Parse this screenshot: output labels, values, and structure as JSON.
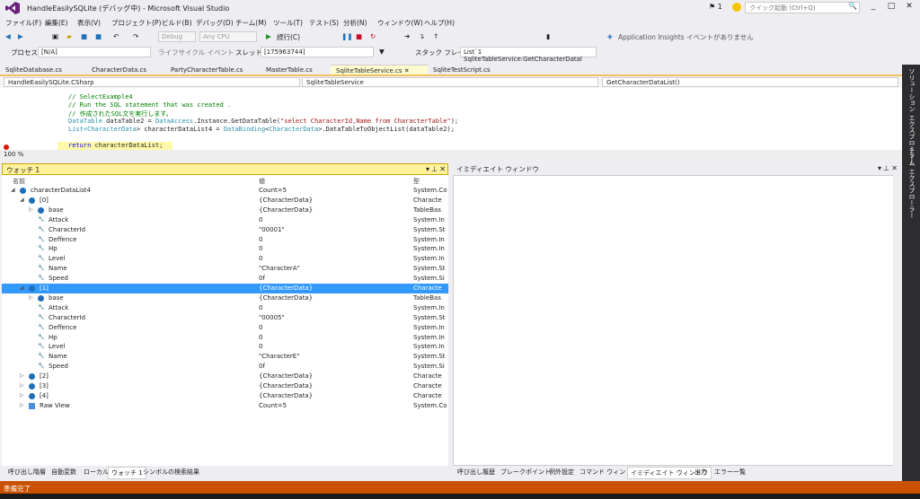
{
  "titlebar": {
    "title": "HandleEasilySQLite (デバッグ中) - Microsoft Visual Studio",
    "notifications": "1",
    "quick_launch_placeholder": "クイック起動 (Ctrl+Q)",
    "minimize": "_",
    "maximize": "□",
    "close": "✕",
    "filter_icon": "🔍"
  },
  "menu": [
    "ファイル(F)",
    "編集(E)",
    "表示(V)",
    "プロジェクト(P)",
    "ビルド(B)",
    "デバッグ(D)",
    "チーム(M)",
    "ツール(T)",
    "テスト(S)",
    "分析(N)",
    "ウィンドウ(W)",
    "ヘルプ(H)"
  ],
  "toolbar1": {
    "config": "Debug",
    "platform": "Any CPU",
    "continue": "続行(C)",
    "insights": "Application Insights イベントがありません"
  },
  "toolbar2": {
    "process_label": "プロセス:",
    "process_value": "[N/A]",
    "lifecycle": "ライフサイクル イベント",
    "thread_label": "スレッド:",
    "thread_value": "[175963744]",
    "stack_label": "スタック フレーム:",
    "stack_value": "List`1 SqliteTableService:GetCharacterDatal"
  },
  "doctabs": [
    "SqliteDatabase.cs",
    "CharacterData.cs",
    "PartyCharacterTable.cs",
    "MasterTable.cs",
    "SqliteTableService.cs",
    "SqliteTestScript.cs"
  ],
  "navbar": {
    "project": "HandleEasilySQLite.CSharp",
    "class": "SqliteTableService",
    "method": "GetCharacterDataList()"
  },
  "code": {
    "l1": "// SelectExample4",
    "l2": "// Run the SQL statement that was created .",
    "l3": "// 作成されたSQL文を実行します。",
    "l4a": "DataTable",
    "l4b": " dataTable2 = ",
    "l4c": "DataAccess",
    "l4d": ".Instance.GetDataTable(",
    "l4e": "\"select CharacterId,Name from CharacterTable\"",
    "l4f": ");",
    "l5a": "List<",
    "l5b": "CharacterData",
    "l5c": "> characterDataList4 = ",
    "l5d": "DataBinding",
    "l5e": "<",
    "l5f": "CharacterData",
    "l5g": ">.DataTableToObjectList(dataTable2);",
    "l6a": "return",
    "l6b": " characterDataList;"
  },
  "zoom": "100 %",
  "right_strip": [
    "ソリューション エクスプローラー",
    "チーム エクスプローラー"
  ],
  "watch": {
    "title": "ウォッチ 1",
    "headers": [
      "名前",
      "値",
      "型"
    ],
    "rows": [
      {
        "name": "characterDataList4",
        "value": "Count=5",
        "type": "System.Co"
      },
      {
        "name": "[0]",
        "value": "{CharacterData}",
        "type": "Characte"
      },
      {
        "name": "base",
        "value": "{CharacterData}",
        "type": "TableBas"
      },
      {
        "name": "Attack",
        "value": "0",
        "type": "System.In"
      },
      {
        "name": "CharacterId",
        "value": "\"00001\"",
        "type": "System.St"
      },
      {
        "name": "Deffence",
        "value": "0",
        "type": "System.In"
      },
      {
        "name": "Hp",
        "value": "0",
        "type": "System.In"
      },
      {
        "name": "Level",
        "value": "0",
        "type": "System.In"
      },
      {
        "name": "Name",
        "value": "\"CharacterA\"",
        "type": "System.St"
      },
      {
        "name": "Speed",
        "value": "0f",
        "type": "System.Si"
      },
      {
        "name": "[1]",
        "value": "{CharacterData}",
        "type": "Characte"
      },
      {
        "name": "base",
        "value": "{CharacterData}",
        "type": "TableBas"
      },
      {
        "name": "Attack",
        "value": "0",
        "type": "System.In"
      },
      {
        "name": "CharacterId",
        "value": "\"00005\"",
        "type": "System.St"
      },
      {
        "name": "Deffence",
        "value": "0",
        "type": "System.In"
      },
      {
        "name": "Hp",
        "value": "0",
        "type": "System.In"
      },
      {
        "name": "Level",
        "value": "0",
        "type": "System.In"
      },
      {
        "name": "Name",
        "value": "\"CharacterE\"",
        "type": "System.St"
      },
      {
        "name": "Speed",
        "value": "0f",
        "type": "System.Si"
      },
      {
        "name": "[2]",
        "value": "{CharacterData}",
        "type": "Characte"
      },
      {
        "name": "[3]",
        "value": "{CharacterData}",
        "type": "Characte"
      },
      {
        "name": "[4]",
        "value": "{CharacterData}",
        "type": "Characte"
      },
      {
        "name": "Raw View",
        "value": "Count=5",
        "type": "System.Co"
      }
    ],
    "tabs": [
      "呼び出し階層",
      "自動変数",
      "ローカル",
      "ウォッチ 1",
      "シンボルの検索結果"
    ]
  },
  "immediate": {
    "title": "イミディエイト ウィンドウ",
    "tabs": [
      "呼び出し履歴",
      "ブレークポイント",
      "例外設定",
      "コマンド ウィンドウ",
      "イミディエイト ウィンドウ",
      "出力",
      "エラー一覧"
    ]
  },
  "status": "準備完了",
  "colors": {
    "status": "#ca5100",
    "selection": "#3399ff",
    "accent": "#68217a"
  }
}
